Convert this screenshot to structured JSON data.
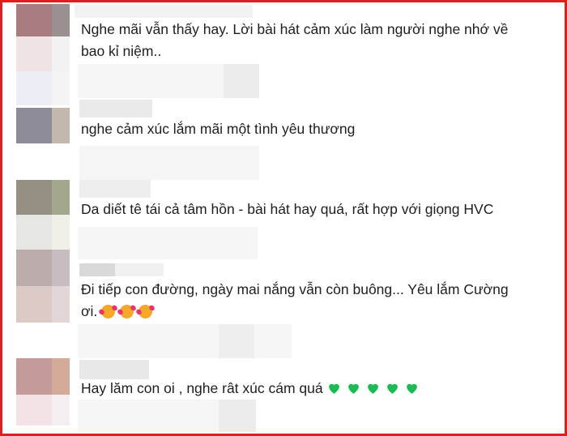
{
  "comments": [
    {
      "line1": "Nghe mãi vẫn thấy hay. Lời bài hát cảm xúc làm người nghe nhớ về",
      "line2": "bao kỉ niệm.."
    },
    {
      "line1": "nghe cảm xúc lắm mãi một tình yêu thương"
    },
    {
      "line1": "Da diết tê tái cả tâm hồn - bài hát hay quá, rất hợp với giọng HVC"
    },
    {
      "line1": "Đi tiếp con đường, ngày mai nắng vẫn còn buông... Yêu lắm Cường",
      "line2": "ơi."
    },
    {
      "line1": "Hay lăm con oi , nghe rât xúc cám quá"
    }
  ],
  "emoji_icons": {
    "smiling_hearts": "smiling-face-with-hearts",
    "green_heart": "green-heart"
  },
  "colors": {
    "frame": "#e01e1e",
    "green_heart": "#1db954",
    "text": "#1c1e21"
  }
}
